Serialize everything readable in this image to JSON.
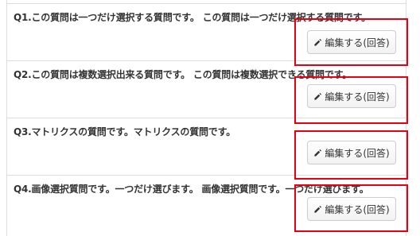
{
  "questions": [
    {
      "text": "Q1.この質問は一つだけ選択する質問です。 この質問は一つだけ選択する質問です。",
      "button_label": "編集する(回答)"
    },
    {
      "text": "Q2.この質問は複数選択出来る質問です。 この質問は複数選択できる質問です。",
      "button_label": "編集する(回答)"
    },
    {
      "text": "Q3.マトリクスの質問です。マトリクスの質問です。",
      "button_label": "編集する(回答)"
    },
    {
      "text": "Q4.画像選択質問です。一つだけ選びます。 画像選択質問です。一つだけ選びます。",
      "button_label": "編集する(回答)"
    }
  ],
  "colors": {
    "highlight": "#e60012",
    "border": "#dddddd",
    "text": "#333333"
  },
  "icons": {
    "edit": "pencil-icon"
  }
}
